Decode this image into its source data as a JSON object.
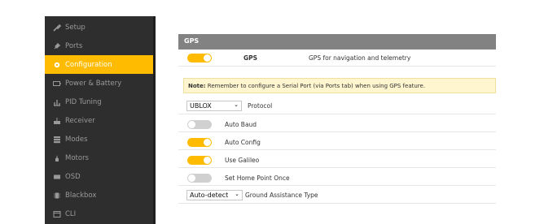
{
  "sidebar": {
    "items": [
      {
        "label": "Setup",
        "icon": "wrench-icon",
        "active": false
      },
      {
        "label": "Ports",
        "icon": "plug-icon",
        "active": false
      },
      {
        "label": "Configuration",
        "icon": "gear-icon",
        "active": true
      },
      {
        "label": "Power & Battery",
        "icon": "battery-icon",
        "active": false
      },
      {
        "label": "PID Tuning",
        "icon": "pid-icon",
        "active": false
      },
      {
        "label": "Receiver",
        "icon": "receiver-icon",
        "active": false
      },
      {
        "label": "Modes",
        "icon": "modes-icon",
        "active": false
      },
      {
        "label": "Motors",
        "icon": "motor-icon",
        "active": false
      },
      {
        "label": "OSD",
        "icon": "osd-icon",
        "active": false
      },
      {
        "label": "Blackbox",
        "icon": "blackbox-icon",
        "active": false
      },
      {
        "label": "CLI",
        "icon": "cli-icon",
        "active": false
      }
    ],
    "active_color": "#ffbb00"
  },
  "gps_panel": {
    "title": "GPS",
    "gps_toggle": {
      "on": true,
      "label": "GPS",
      "description": "GPS for navigation and telemetry"
    },
    "note": {
      "prefix": "Note:",
      "text": "Remember to configure a Serial Port (via Ports tab) when using GPS feature."
    },
    "protocol": {
      "value": "UBLOX",
      "label": "Protocol"
    },
    "auto_baud": {
      "on": false,
      "label": "Auto Baud"
    },
    "auto_config": {
      "on": true,
      "label": "Auto Config"
    },
    "use_galileo": {
      "on": true,
      "label": "Use Galileo"
    },
    "set_home_point_once": {
      "on": false,
      "label": "Set Home Point Once"
    },
    "ground_assistance": {
      "value": "Auto-detect",
      "label": "Ground Assistance Type"
    }
  }
}
